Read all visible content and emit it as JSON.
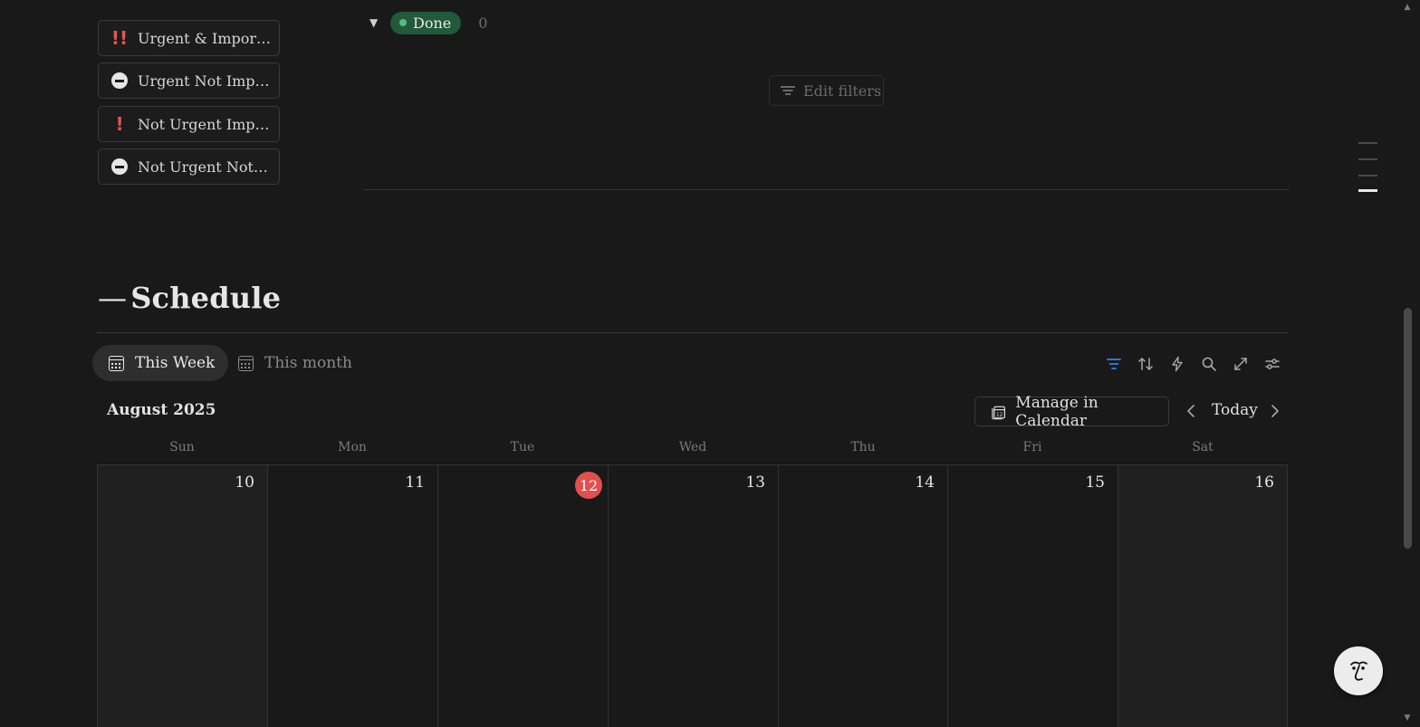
{
  "priority_buttons": [
    {
      "label": "Urgent & Import...",
      "icon": "double-exclamation-icon"
    },
    {
      "label": "Urgent Not Impo...",
      "icon": "no-entry-icon"
    },
    {
      "label": "Not Urgent Impo...",
      "icon": "exclamation-icon"
    },
    {
      "label": "Not Urgent Not I...",
      "icon": "no-entry-icon"
    }
  ],
  "done_group": {
    "label": "Done",
    "count": "0",
    "pill_color": "#21593a",
    "dot_color": "#4fbf7f"
  },
  "edit_filters_label": "Edit filters",
  "schedule": {
    "dash": "—",
    "title": "Schedule"
  },
  "tabs": [
    {
      "label": "This Week",
      "active": true
    },
    {
      "label": "This month",
      "active": false
    }
  ],
  "toolbar_icons": [
    "filter-icon",
    "sort-icon",
    "automation-bolt-icon",
    "search-icon",
    "expand-icon",
    "settings-sliders-icon"
  ],
  "calendar": {
    "month": "August 2025",
    "manage_label": "Manage in Calendar",
    "today_label": "Today",
    "weekdays": [
      "Sun",
      "Mon",
      "Tue",
      "Wed",
      "Thu",
      "Fri",
      "Sat"
    ],
    "days": [
      "10",
      "11",
      "12",
      "13",
      "14",
      "15",
      "16"
    ],
    "today_index": 2,
    "today_color": "#e0504f",
    "accent": "#2e83e6"
  }
}
